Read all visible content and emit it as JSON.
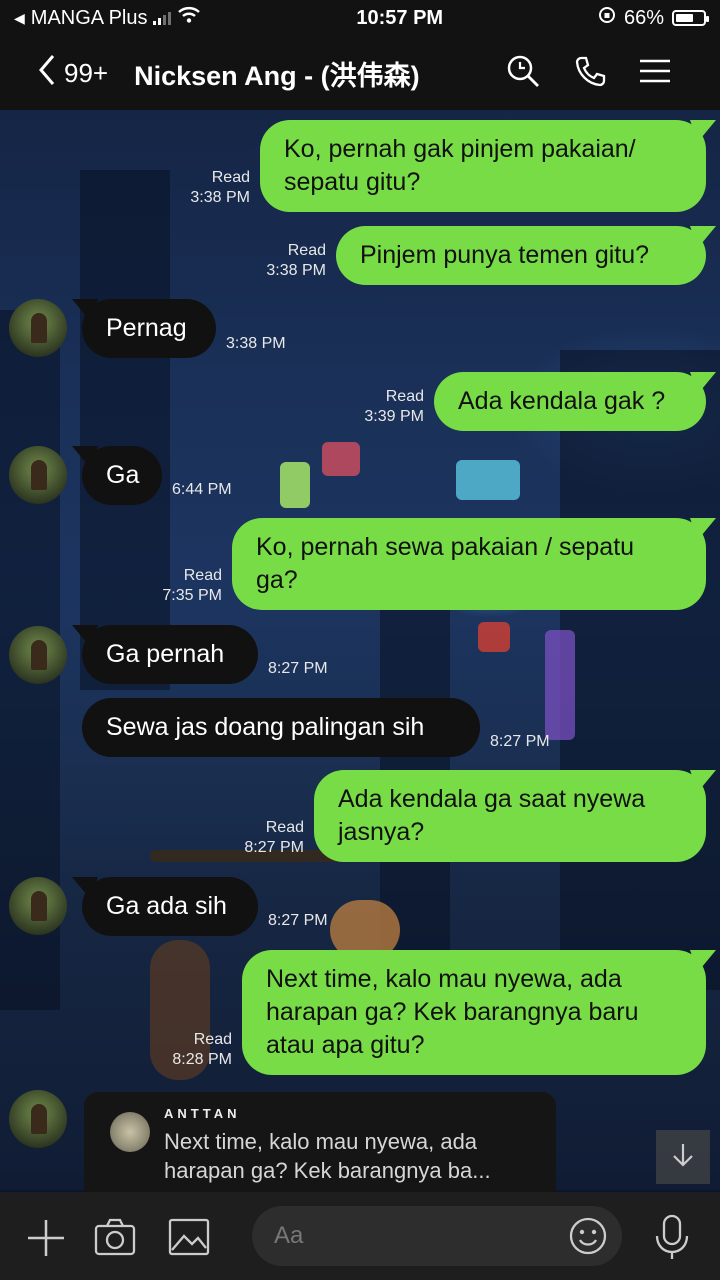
{
  "status_bar": {
    "back_app": "MANGA Plus",
    "time": "10:57 PM",
    "battery": "66%",
    "battery_level": 0.66
  },
  "header": {
    "unread_count": "99+",
    "title": "Nicksen Ang - (洪伟森)"
  },
  "messages": [
    {
      "side": "sent",
      "lines": [
        "Ko, pernah gak pinjem pakaian/",
        "sepatu gitu?"
      ],
      "read": "Read",
      "time": "3:38 PM"
    },
    {
      "side": "sent",
      "lines": [
        "Pinjem punya temen gitu?"
      ],
      "read": "Read",
      "time": "3:38 PM"
    },
    {
      "side": "recv",
      "lines": [
        "Pernag"
      ],
      "time": "3:38 PM"
    },
    {
      "side": "sent",
      "lines": [
        "Ada kendala gak ?"
      ],
      "read": "Read",
      "time": "3:39 PM"
    },
    {
      "side": "recv",
      "lines": [
        "Ga"
      ],
      "time": "6:44 PM"
    },
    {
      "side": "sent",
      "lines": [
        "Ko, pernah sewa pakaian / sepatu",
        "ga?"
      ],
      "read": "Read",
      "time": "7:35 PM"
    },
    {
      "side": "recv",
      "lines": [
        "Ga pernah"
      ],
      "time": "8:27 PM"
    },
    {
      "side": "recv",
      "lines": [
        "Sewa jas doang palingan sih"
      ],
      "time": "8:27 PM"
    },
    {
      "side": "sent",
      "lines": [
        "Ada kendala ga saat nyewa",
        "jasnya?"
      ],
      "read": "Read",
      "time": "8:27 PM"
    },
    {
      "side": "recv",
      "lines": [
        "Ga ada sih"
      ],
      "time": "8:27 PM"
    },
    {
      "side": "sent",
      "lines": [
        "Next time, kalo mau nyewa, ada",
        "harapan ga? Kek barangnya baru",
        "atau apa gitu?"
      ],
      "read": "Read",
      "time": "8:28 PM"
    }
  ],
  "reply_preview": {
    "name": "ANTTAN",
    "lines": [
      "Next time, kalo mau nyewa, ada",
      "harapan ga? Kek barangnya ba..."
    ]
  },
  "composer": {
    "placeholder": "Aa"
  },
  "icons": {
    "header": [
      "back-chevron-icon",
      "search-icon",
      "phone-icon",
      "menu-icon"
    ],
    "bottom": [
      "plus-icon",
      "camera-icon",
      "image-icon",
      "emoji-icon",
      "microphone-icon"
    ]
  },
  "colors": {
    "sent_bubble": "#78dc46",
    "recv_bubble": "#111111",
    "header_bg": "#121212"
  }
}
